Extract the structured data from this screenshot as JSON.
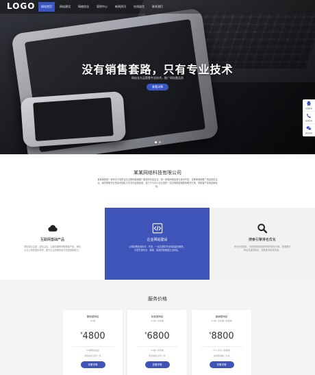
{
  "header": {
    "logo": "LOGO",
    "nav": [
      "网站首页",
      "网站建设",
      "网络优化",
      "案例中心",
      "新闻资讯",
      "在线留言",
      "联系我们"
    ]
  },
  "hero": {
    "title": "没有销售套路，只有专业技术",
    "subtitle": "网站长久运营靠专业技术，推广网站靠品质",
    "button": "查看详情"
  },
  "sidebar": {
    "items": [
      {
        "icon": "qq-icon",
        "label": "在线咨询"
      },
      {
        "icon": "phone-icon",
        "label": "电话咨询"
      },
      {
        "icon": "wechat-icon",
        "label": "微信咨询"
      }
    ]
  },
  "about": {
    "title": "某某网络科技有限公司",
    "text": "某某网络是一家专业于提供企业互联网营销推广服务的科技企业，是一家集网络运营与技术开发、互联网营销推广的高科技企业，我们拥有专业的技术团队与丰富的运营经验，致力于为中小企业提供一站式网络营销整体解决方案，帮助客户实现营销目标。"
  },
  "services": [
    {
      "icon": "cloud-icon",
      "title": "互联网基础产品",
      "desc": "提供域名注册、虚拟主机、云服务器等网络基础产品，满足企业上网的基本需求，提升企业品牌形象与在线营销能力。"
    },
    {
      "icon": "code-icon",
      "title": "企业网站建设",
      "desc": "从网站策划到设计、开发，一站式提供专业网站建设服务，为您打造专业、美观、易用的营销型企业网站。"
    },
    {
      "icon": "search-icon",
      "title": "搜索引擎排名优化",
      "desc": "专业优化团队，为您的网站制定科学的优化方案，快速提升网站关键词排名，获取更多精准流量。"
    }
  ],
  "pricing": {
    "title": "服务价格",
    "plans": [
      {
        "name": "基础型网站",
        "sub": "PC端",
        "currency": "¥",
        "price": "4800",
        "features": [
          "PC端网站建设",
          "赠送域名空间一年"
        ],
        "button": "查看详情"
      },
      {
        "name": "标准型网站",
        "sub": "PC端+手机端",
        "currency": "¥",
        "price": "6800",
        "features": [
          "PC端+手机端",
          "赠送域名空间一年"
        ],
        "button": "查看详情"
      },
      {
        "name": "营销型网站",
        "sub": "PC端+手机端+微信端",
        "currency": "¥",
        "price": "8800",
        "features": [
          "PC+手机+微信端",
          "全网营销推广方案"
        ],
        "button": "查看详情"
      }
    ]
  },
  "colors": {
    "accent": "#3f54b8",
    "nav_active": "#3a56c5"
  }
}
